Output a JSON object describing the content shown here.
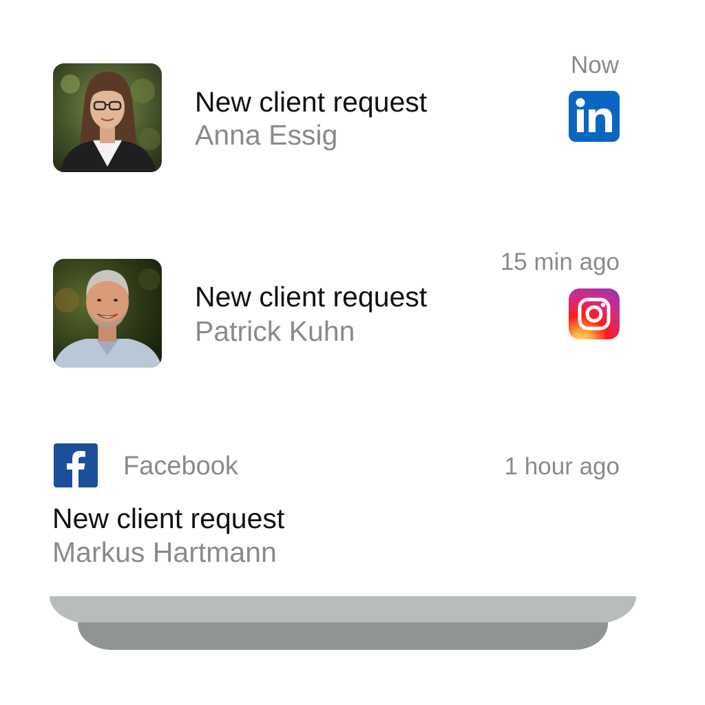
{
  "notifications": [
    {
      "title": "New client request",
      "name": "Anna Essig",
      "time": "Now",
      "app_icon": "linkedin-icon",
      "app_color": "#0a66c2"
    },
    {
      "title": "New client request",
      "name": "Patrick Kuhn",
      "time": "15 min ago",
      "app_icon": "instagram-icon"
    },
    {
      "title": "New client request",
      "name": "Markus Hartmann",
      "time": "1 hour ago",
      "app": "Facebook",
      "app_icon": "facebook-icon",
      "app_color": "#1b4f9c"
    }
  ],
  "colors": {
    "title_text": "#111111",
    "secondary_text": "#8a8a8a",
    "stack_shadow_top": "#b7bcbc",
    "stack_shadow_bottom": "#909494"
  }
}
